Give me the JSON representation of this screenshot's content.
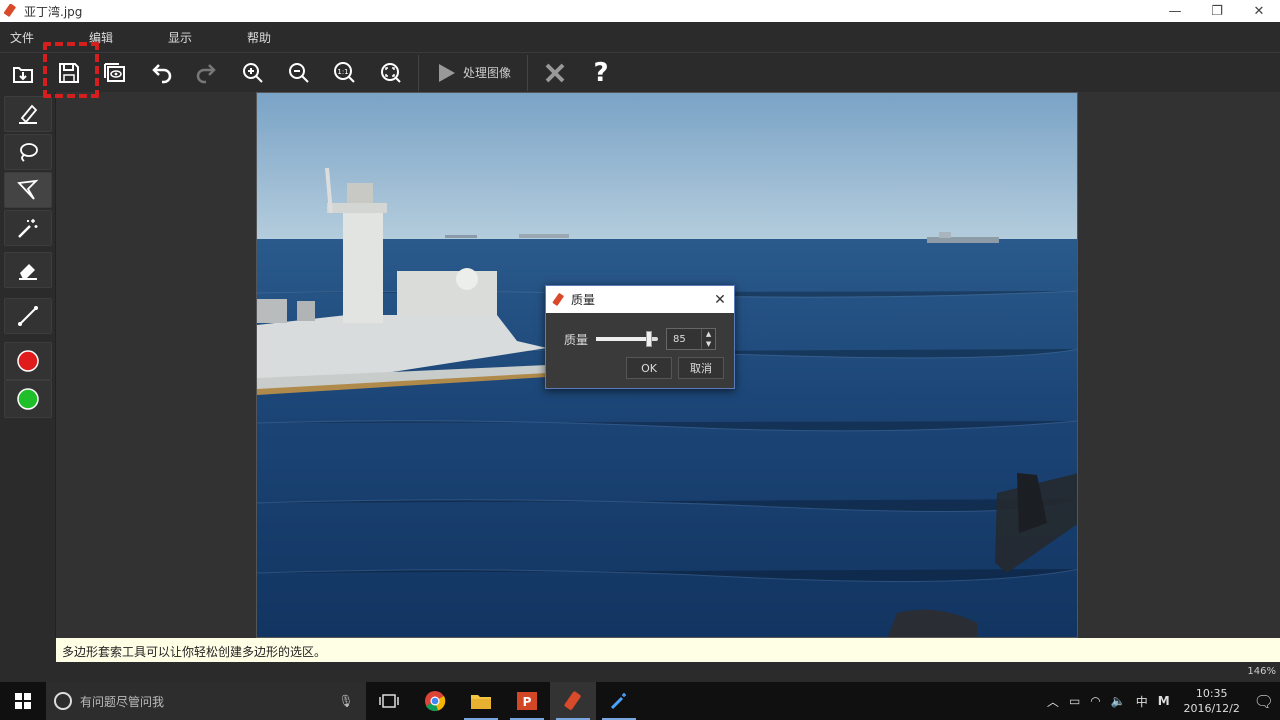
{
  "window": {
    "title": "亚丁湾.jpg",
    "minimize": "—",
    "restore": "❐",
    "close": "✕"
  },
  "menu": {
    "items": [
      "文件",
      "编辑",
      "显示",
      "帮助"
    ]
  },
  "toolbar": {
    "process_label": "处理图像",
    "help_label": "?",
    "zoom_actual_label": "1:1"
  },
  "status": {
    "hint": "多边形套索工具可以让你轻松创建多边形的选区。",
    "zoom": "146%"
  },
  "dialog": {
    "title": "质量",
    "quality_label": "质量",
    "quality_value": "85",
    "quality_fraction": 0.85,
    "ok_label": "OK",
    "cancel_label": "取消",
    "close": "✕"
  },
  "colors": {
    "primary": "#e01b1b",
    "secondary": "#1fbf2a",
    "highlight": "#d41f1f"
  },
  "taskbar": {
    "search_placeholder": "有问题尽管问我",
    "ime": "中",
    "ime2": "M",
    "time": "10:35",
    "date": "2016/12/2"
  }
}
